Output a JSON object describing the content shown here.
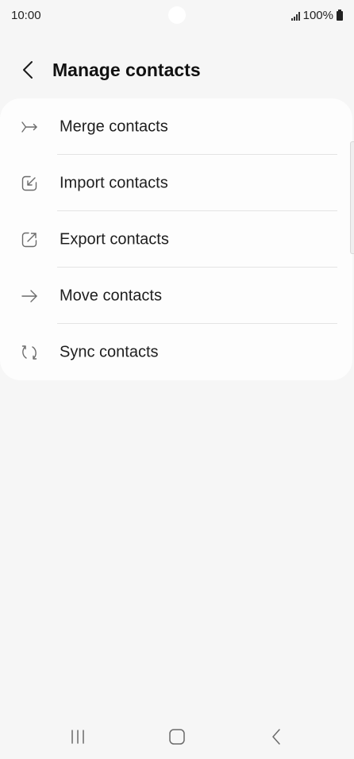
{
  "status_bar": {
    "time": "10:00",
    "battery": "100%"
  },
  "header": {
    "title": "Manage contacts",
    "back_icon": "chevron-left-icon"
  },
  "menu": {
    "items": [
      {
        "label": "Merge contacts",
        "icon": "merge-icon"
      },
      {
        "label": "Import contacts",
        "icon": "import-icon"
      },
      {
        "label": "Export contacts",
        "icon": "export-icon"
      },
      {
        "label": "Move contacts",
        "icon": "arrow-right-icon"
      },
      {
        "label": "Sync contacts",
        "icon": "sync-icon"
      }
    ]
  },
  "nav_bar": {
    "buttons": [
      "recents-icon",
      "home-icon",
      "back-icon"
    ]
  },
  "colors": {
    "background": "#f6f6f6",
    "card": "#fdfdfd",
    "icon_stroke": "#6b6b6b",
    "divider": "#e4e4e4"
  }
}
